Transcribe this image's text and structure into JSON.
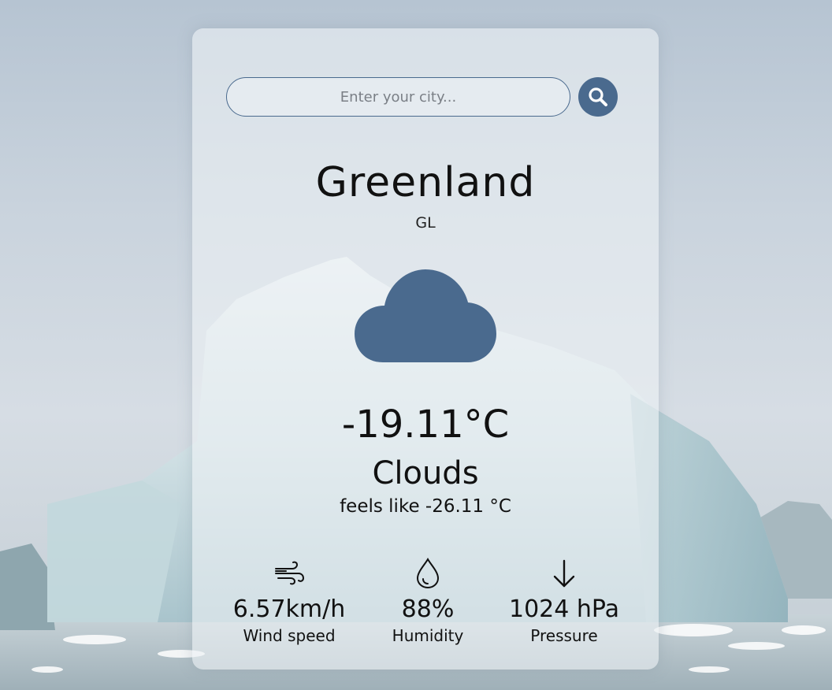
{
  "search": {
    "placeholder": "Enter your city...",
    "icon": "search-icon"
  },
  "location": {
    "city": "Greenland",
    "country": "GL"
  },
  "weather": {
    "icon": "cloud-icon",
    "temperature": "-19.11°C",
    "condition": "Clouds",
    "feels_like": "feels like -26.11 °C"
  },
  "stats": {
    "wind": {
      "value": "6.57km/h",
      "label": "Wind speed",
      "icon": "wind-icon"
    },
    "humidity": {
      "value": "88%",
      "label": "Humidity",
      "icon": "droplet-icon"
    },
    "pressure": {
      "value": "1024 hPa",
      "label": "Pressure",
      "icon": "arrow-down-icon"
    }
  },
  "colors": {
    "accent": "#4a6a8e",
    "text": "#111111",
    "card": "#ecf0f4"
  }
}
